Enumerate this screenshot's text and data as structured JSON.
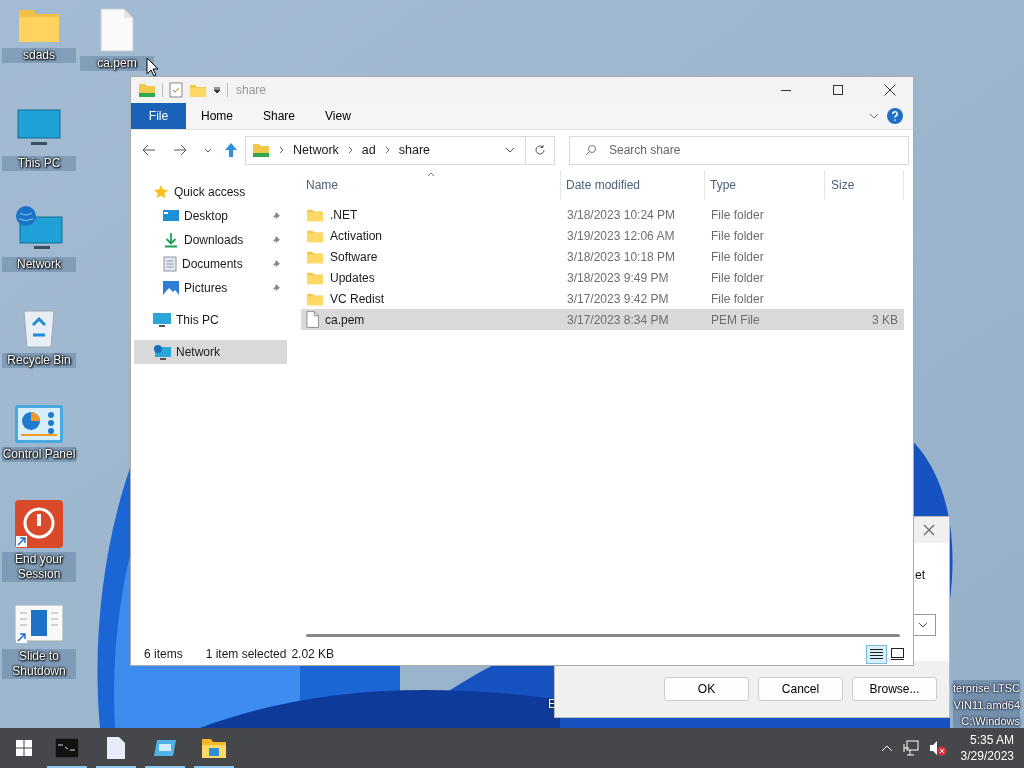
{
  "desktop_icons": [
    {
      "label": "sdads",
      "kind": "folder"
    },
    {
      "label": "ca.pem",
      "kind": "file"
    },
    {
      "label": "This PC",
      "kind": "computer"
    },
    {
      "label": "Network",
      "kind": "network"
    },
    {
      "label": "Recycle Bin",
      "kind": "recycle"
    },
    {
      "label": "Control Panel",
      "kind": "control"
    },
    {
      "label": "End your Session",
      "kind": "power"
    },
    {
      "label": "Slide to Shutdown",
      "kind": "slide"
    }
  ],
  "watermark_fragment": "E",
  "watermark_lines": [
    "terprise LTSC",
    "VIN11.amd64",
    "C:\\Windows"
  ],
  "back_dialog": {
    "partial_text": "et",
    "buttons": [
      "OK",
      "Cancel",
      "Browse..."
    ]
  },
  "explorer": {
    "title": "share",
    "ribbon_tabs": [
      {
        "label": "File",
        "kind": "file"
      },
      {
        "label": "Home",
        "kind": "tab"
      },
      {
        "label": "Share",
        "kind": "tab"
      },
      {
        "label": "View",
        "kind": "tab"
      }
    ],
    "breadcrumbs": [
      "Network",
      "ad",
      "share"
    ],
    "search": {
      "placeholder": "Search share"
    },
    "nav": [
      {
        "label": "Quick access",
        "kind": "star",
        "selected": false,
        "children": [
          {
            "label": "Desktop",
            "kind": "desktop",
            "selected": false,
            "pinned": true
          },
          {
            "label": "Downloads",
            "kind": "downloads",
            "selected": false,
            "pinned": true
          },
          {
            "label": "Documents",
            "kind": "documents",
            "selected": false,
            "pinned": true
          },
          {
            "label": "Pictures",
            "kind": "pictures",
            "selected": false,
            "pinned": true
          }
        ]
      },
      {
        "label": "This PC",
        "kind": "computer",
        "selected": false
      },
      {
        "label": "Network",
        "kind": "network",
        "selected": true
      }
    ],
    "columns": [
      {
        "label": "Name",
        "sorted": true
      },
      {
        "label": "Date modified",
        "sorted": false
      },
      {
        "label": "Type",
        "sorted": false
      },
      {
        "label": "Size",
        "sorted": false
      }
    ],
    "rows": [
      {
        "name": ".NET",
        "date": "3/18/2023 10:24 PM",
        "type": "File folder",
        "kind": "folder",
        "selected": false
      },
      {
        "name": "Activation",
        "date": "3/19/2023 12:06 AM",
        "type": "File folder",
        "kind": "folder",
        "selected": false
      },
      {
        "name": "Software",
        "date": "3/18/2023 10:18 PM",
        "type": "File folder",
        "kind": "folder",
        "selected": false
      },
      {
        "name": "Updates",
        "date": "3/18/2023 9:49 PM",
        "type": "File folder",
        "kind": "folder",
        "selected": false
      },
      {
        "name": "VC Redist",
        "date": "3/17/2023 9:42 PM",
        "type": "File folder",
        "kind": "folder",
        "selected": false
      },
      {
        "name": "ca.pem",
        "date": "3/17/2023 8:34 PM",
        "type": "PEM File",
        "size": "3 KB",
        "kind": "file",
        "selected": true
      }
    ],
    "status": {
      "count": "6 items",
      "selection": "1 item selected",
      "size": "2.02 KB"
    },
    "view_buttons": [
      {
        "kind": "details",
        "selected": true
      },
      {
        "kind": "large-icons",
        "selected": false
      }
    ]
  },
  "taskbar": {
    "apps": [
      {
        "kind": "terminal",
        "running": true
      },
      {
        "kind": "document",
        "running": true
      },
      {
        "kind": "app",
        "running": true
      },
      {
        "kind": "explorer",
        "running": true
      }
    ],
    "volume_muted": true,
    "time": "5:35 AM",
    "date": "3/29/2023"
  }
}
